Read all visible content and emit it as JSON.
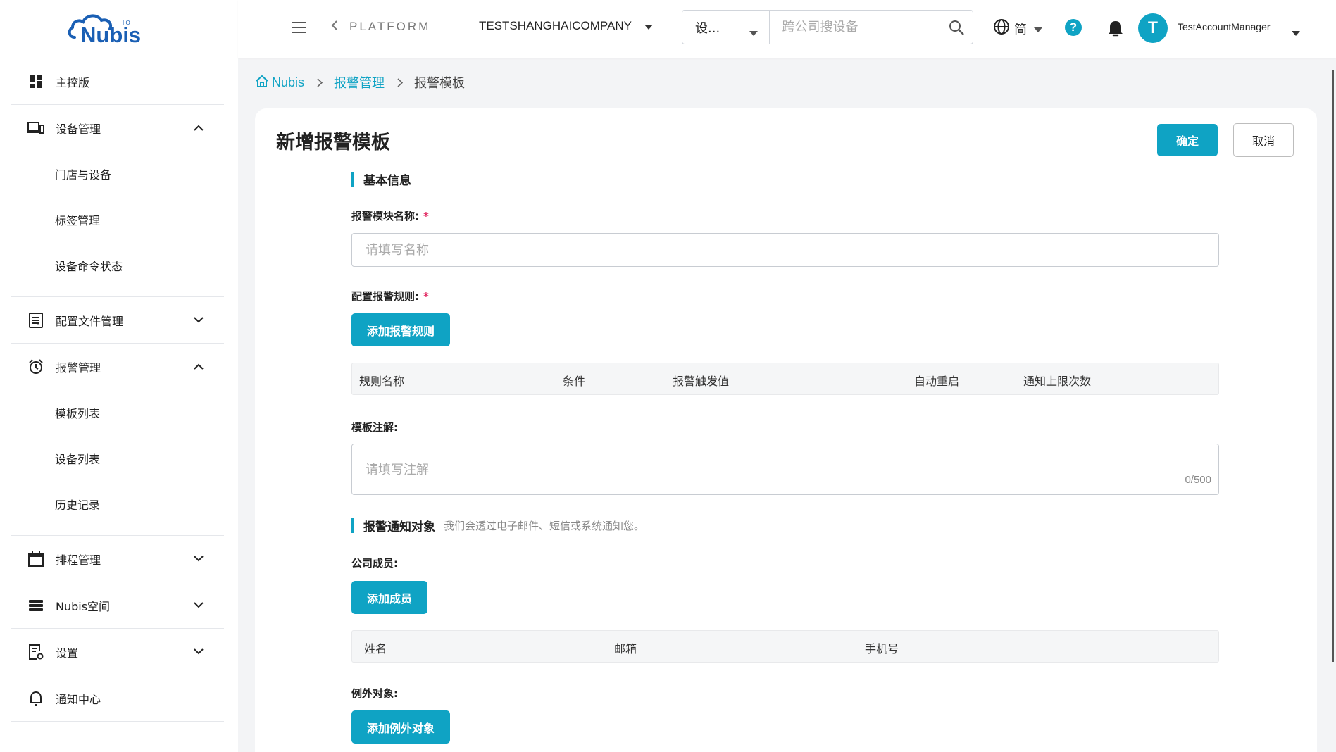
{
  "brand": {
    "name": "Nubis",
    "sup": "IIO"
  },
  "sidebar": {
    "items": [
      {
        "label": "主控版",
        "icon": "dashboard-icon"
      },
      {
        "label": "设备管理",
        "icon": "devices-icon",
        "expanded": true,
        "children": [
          "门店与设备",
          "标签管理",
          "设备命令状态"
        ]
      },
      {
        "label": "配置文件管理",
        "icon": "config-file-icon",
        "expanded": false
      },
      {
        "label": "报警管理",
        "icon": "alarm-clock-icon",
        "expanded": true,
        "children": [
          "模板列表",
          "设备列表",
          "历史记录"
        ]
      },
      {
        "label": "排程管理",
        "icon": "calendar-icon",
        "expanded": false
      },
      {
        "label": "Nubis空间",
        "icon": "storage-icon",
        "expanded": false
      },
      {
        "label": "设置",
        "icon": "settings-doc-icon",
        "expanded": false
      },
      {
        "label": "通知中心",
        "icon": "bell-outline-icon"
      }
    ]
  },
  "header": {
    "platform": "PLATFORM",
    "company": "TESTSHANGHAICOMPANY",
    "search_type": "设...",
    "search_placeholder": "跨公司搜设备",
    "language": "简",
    "help": "?",
    "avatar_initial": "T",
    "username": "TestAccountManager"
  },
  "breadcrumb": {
    "home": "Nubis",
    "parent": "报警管理",
    "current": "报警模板"
  },
  "page": {
    "title": "新增报警模板",
    "ok_label": "确定",
    "cancel_label": "取消"
  },
  "form": {
    "basic_section": "基本信息",
    "name_label": "报警模块名称:",
    "name_placeholder": "请填写名称",
    "required_mark": "*",
    "rules_label": "配置报警规则:",
    "add_rule_label": "添加报警规则",
    "rule_columns": [
      "规则名称",
      "条件",
      "报警触发值",
      "自动重启",
      "通知上限次数"
    ],
    "note_label": "模板注解:",
    "note_placeholder": "请填写注解",
    "note_counter": "0/500",
    "notify_section": "报警通知对象",
    "notify_desc": "我们会透过电子邮件、短信或系统通知您。",
    "members_label": "公司成员:",
    "add_member_label": "添加成员",
    "member_columns": [
      "姓名",
      "邮箱",
      "手机号"
    ],
    "exception_label": "例外对象:",
    "add_exception_label": "添加例外对象"
  },
  "colors": {
    "accent": "#0fa3c4",
    "required": "#e0245e"
  }
}
